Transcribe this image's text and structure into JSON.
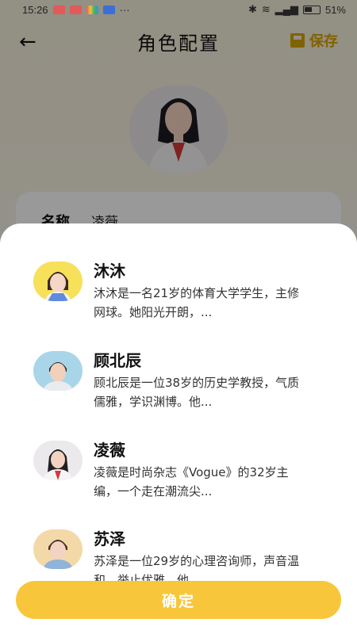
{
  "status_bar": {
    "time": "15:26",
    "icons": [
      "app-icon-red",
      "app-icon-red",
      "app-icon-multicolor",
      "vpn-icon"
    ],
    "more": "···",
    "signal_text": "⁴ᴳ",
    "battery": "51%"
  },
  "app_bar": {
    "title": "角色配置",
    "back_icon": "back-arrow-icon",
    "save_label": "保存",
    "save_icon": "save-icon"
  },
  "form": {
    "name_label": "名称",
    "name_value": "凌薇"
  },
  "roles": [
    {
      "name": "沐沐",
      "desc": "沐沐是一名21岁的体育大学学生，主修网球。她阳光开朗，..."
    },
    {
      "name": "顾北辰",
      "desc": "顾北辰是一位38岁的历史学教授，气质儒雅，学识渊博。他..."
    },
    {
      "name": "凌薇",
      "desc": "凌薇是时尚杂志《Vogue》的32岁主编，一个走在潮流尖..."
    },
    {
      "name": "苏泽",
      "desc": "苏泽是一位29岁的心理咨询师，声音温和，举止优雅。他..."
    }
  ],
  "confirm_label": "确定",
  "colors": {
    "accent": "#f8c63a",
    "save_text": "#d8a400",
    "sheet_bg": "#ffffff"
  }
}
